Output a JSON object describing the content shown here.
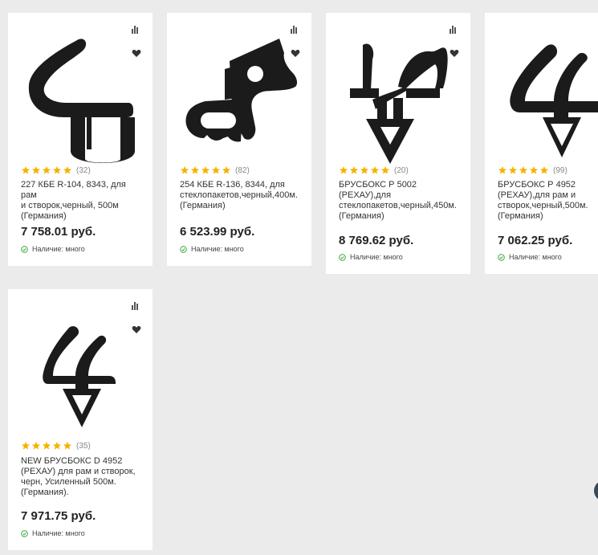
{
  "colors": {
    "star": "#f5b301",
    "stock_icon": "#4caf50",
    "profile": "#1b1b1b"
  },
  "products": [
    {
      "rating_count": "(32)",
      "title_lines": [
        "227 КБЕ R-104, 8343, для рам",
        "и створок,черный, 500м",
        "(Германия)"
      ],
      "price": "7 758.01 руб.",
      "stock": "Наличие: много",
      "stars": 5,
      "icons": [
        "compare-icon",
        "heart-icon"
      ]
    },
    {
      "rating_count": "(82)",
      "title_lines": [
        "254 КБЕ R-136, 8344, для",
        "стеклопакетов,черный,400м.",
        "(Германия)"
      ],
      "price": "6 523.99 руб.",
      "stock": "Наличие: много",
      "stars": 5,
      "icons": [
        "compare-icon",
        "heart-icon"
      ]
    },
    {
      "rating_count": "(20)",
      "title_lines": [
        "БРУСБОКС Р 5002",
        "(РЕХАУ),для",
        "стеклопакетов,черный,450м.",
        "(Германия)"
      ],
      "price": "8 769.62 руб.",
      "stock": "Наличие: много",
      "stars": 5,
      "icons": [
        "compare-icon",
        "heart-icon"
      ]
    },
    {
      "rating_count": "(99)",
      "title_lines": [
        "БРУСБОКС Р 4952",
        "(РЕХАУ),для рам и",
        "створок,черный,500м.",
        "(Германия)"
      ],
      "price": "7 062.25 руб.",
      "stock": "Наличие: много",
      "stars": 5,
      "icons": [
        "compare-icon",
        "heart-icon"
      ]
    },
    {
      "rating_count": "(35)",
      "title_lines": [
        "NEW БРУСБОКС D 4952",
        "(РЕХАУ) для рам и створок,",
        "черн, Усиленный 500м.",
        "(Германия)."
      ],
      "price": "7 971.75 руб.",
      "stock": "Наличие: много",
      "stars": 5,
      "icons": [
        "compare-icon",
        "heart-icon"
      ]
    }
  ]
}
